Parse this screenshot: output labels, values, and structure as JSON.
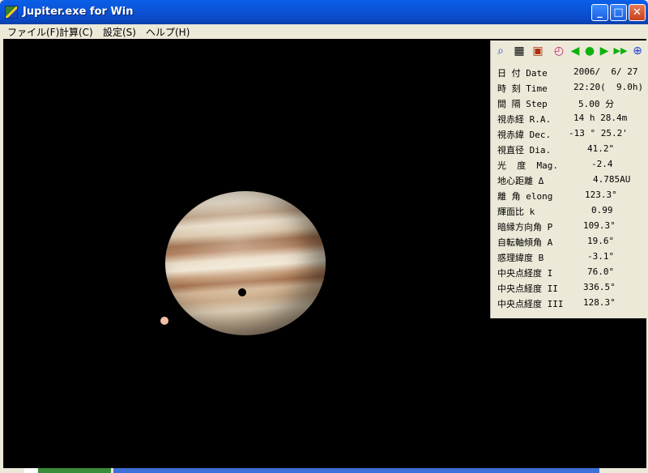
{
  "window": {
    "title": "Jupiter.exe for Win"
  },
  "menu": [
    {
      "label": "ファイル(F)"
    },
    {
      "label": "計算(C)"
    },
    {
      "label": "設定(S)"
    },
    {
      "label": "ヘルプ(H)"
    }
  ],
  "toolbar": [
    {
      "icon": "magnifier-icon",
      "glyph": "🔍"
    },
    {
      "icon": "grid-icon",
      "glyph": "▦"
    },
    {
      "icon": "panel-icon",
      "glyph": "▣"
    },
    {
      "icon": "clock-icon",
      "glyph": "◴"
    },
    {
      "icon": "step-back-icon",
      "glyph": "◀"
    },
    {
      "icon": "stop-icon",
      "glyph": "●"
    },
    {
      "icon": "step-forward-icon",
      "glyph": "▶"
    },
    {
      "icon": "fast-forward-icon",
      "glyph": "▶▶"
    },
    {
      "icon": "rotate-clock-icon",
      "glyph": "⊕"
    }
  ],
  "info": [
    {
      "label": "日 付 Date",
      "value": "2006/  6/ 27"
    },
    {
      "label": "時 刻 Time",
      "value": "22:20(  9.0h)"
    },
    {
      "label": "間 隔 Step",
      "value": "5.00 分"
    },
    {
      "label": "視赤経 R.A.",
      "value": "14 h 28.4m"
    },
    {
      "label": "視赤緯 Dec.",
      "value": "-13 ° 25.2'"
    },
    {
      "label": "視直径 Dia.",
      "value": "41.2\""
    },
    {
      "label": "光  度  Mag.",
      "value": "-2.4"
    },
    {
      "label": "地心距離 Δ",
      "value": "4.785AU"
    },
    {
      "label": "離 角 elong",
      "value": "123.3°"
    },
    {
      "label": "輝面比 k",
      "value": "0.99"
    },
    {
      "label": "暗縁方向角 P",
      "value": "109.3°"
    },
    {
      "label": "自転軸傾角 A",
      "value": "19.6°"
    },
    {
      "label": "惑理緯度 B",
      "value": "-3.1°"
    },
    {
      "label": "中央点経度 I",
      "value": "76.0°"
    },
    {
      "label": "中央点経度 II",
      "value": "336.5°"
    },
    {
      "label": "中央点経度 III",
      "value": "128.3°"
    }
  ],
  "colors": {
    "titlebar": "#0a5fe8",
    "canvas": "#000000",
    "moon": "#f2c0a8"
  }
}
